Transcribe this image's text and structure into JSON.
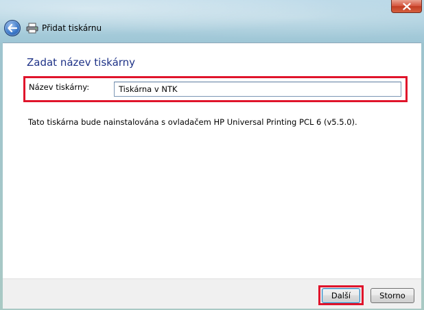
{
  "window": {
    "title": "Přidat tiskárnu"
  },
  "heading": "Zadat název tiskárny",
  "form": {
    "printer_name_label": "Název tiskárny:",
    "printer_name_value": "Tiskárna v NTK"
  },
  "info_text": "Tato tiskárna bude nainstalována s ovladačem HP Universal Printing PCL 6 (v5.5.0).",
  "buttons": {
    "next_label": "Další",
    "cancel_label": "Storno"
  },
  "icons": {
    "close": "close-icon",
    "back": "back-arrow-icon",
    "printer": "printer-icon"
  },
  "colors": {
    "heading": "#1e3287",
    "highlight": "#e0142b",
    "close_button": "#c23c22"
  }
}
